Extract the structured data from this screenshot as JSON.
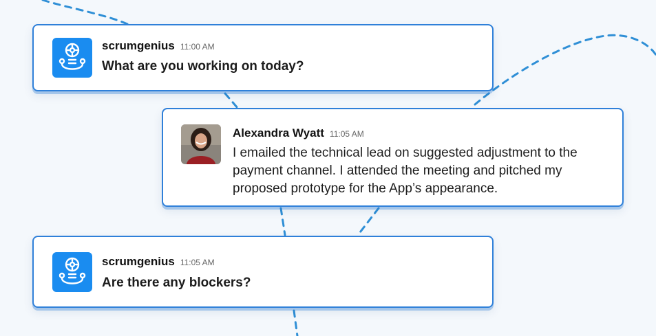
{
  "messages": [
    {
      "author": "scrumgenius",
      "time": "11:00 AM",
      "text": "What are you working on today?",
      "avatar_icon": "bot-logo-icon"
    },
    {
      "author": "Alexandra Wyatt",
      "time": "11:05 AM",
      "text": "I emailed the technical lead on suggested adjustment to the payment channel. I attended the meeting and pitched my proposed prototype for the App’s appearance.",
      "avatar_icon": "user-photo-avatar"
    },
    {
      "author": "scrumgenius",
      "time": "11:05 AM",
      "text": "Are there any blockers?",
      "avatar_icon": "bot-logo-icon"
    }
  ],
  "colors": {
    "accent": "#2f80d9",
    "bot_avatar": "#1a8cf0",
    "background": "#f4f8fc",
    "dash_line": "#2f8fd6"
  }
}
